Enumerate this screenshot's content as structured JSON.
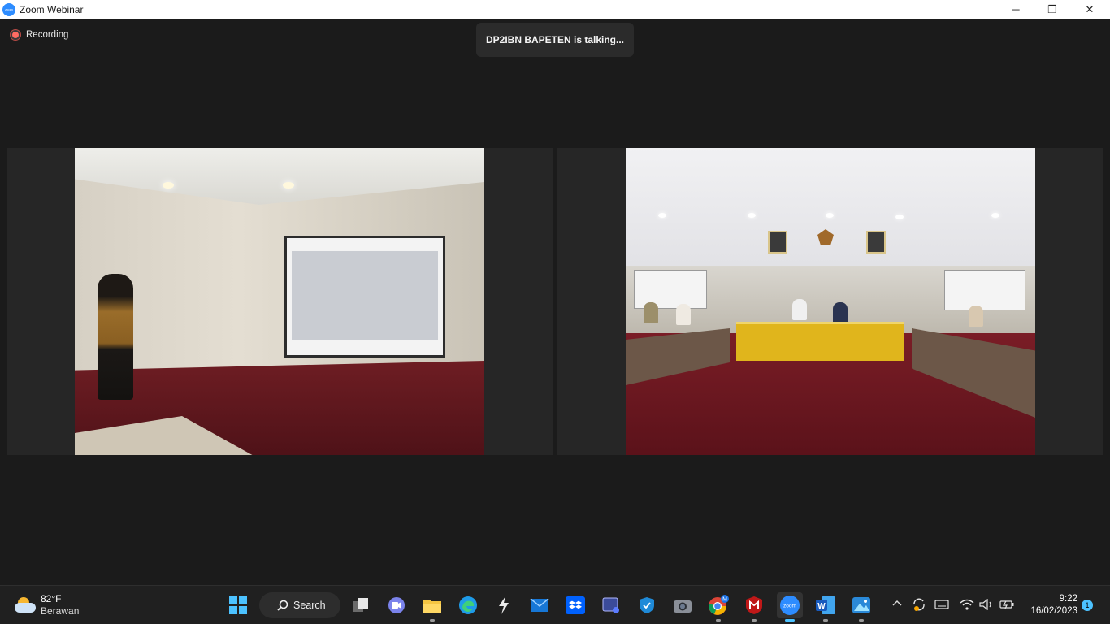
{
  "window": {
    "title": "Zoom Webinar",
    "logo_text": "zoom",
    "minimize": "─",
    "restore": "❐",
    "close": "✕"
  },
  "meeting": {
    "recording_label": "Recording",
    "talking_banner": "DP2IBN BAPETEN is talking..."
  },
  "taskbar": {
    "weather": {
      "temperature": "82°F",
      "condition": "Berawan",
      "icon": "partly-cloudy-icon"
    },
    "search_label": "Search",
    "apps": [
      {
        "name": "task-view",
        "icon": "task-view-icon"
      },
      {
        "name": "teams-meet",
        "icon": "video-chat-icon"
      },
      {
        "name": "file-explorer",
        "icon": "folder-icon"
      },
      {
        "name": "edge",
        "icon": "edge-icon"
      },
      {
        "name": "app-s",
        "icon": "lightning-icon"
      },
      {
        "name": "mail",
        "icon": "mail-icon"
      },
      {
        "name": "dropbox",
        "icon": "dropbox-icon"
      },
      {
        "name": "screen-app",
        "icon": "screen-icon"
      },
      {
        "name": "defender",
        "icon": "shield-icon"
      },
      {
        "name": "camera",
        "icon": "camera-icon"
      },
      {
        "name": "chrome",
        "icon": "chrome-icon",
        "badge": "M"
      },
      {
        "name": "mcafee",
        "icon": "mcafee-icon"
      },
      {
        "name": "zoom",
        "icon": "zoom-icon",
        "label": "zoom"
      },
      {
        "name": "word",
        "icon": "word-icon",
        "label": "W"
      },
      {
        "name": "photos",
        "icon": "photos-icon"
      }
    ],
    "tray": {
      "chevron": "^",
      "time": "9:22",
      "date": "16/02/2023",
      "notifications": "1"
    }
  }
}
